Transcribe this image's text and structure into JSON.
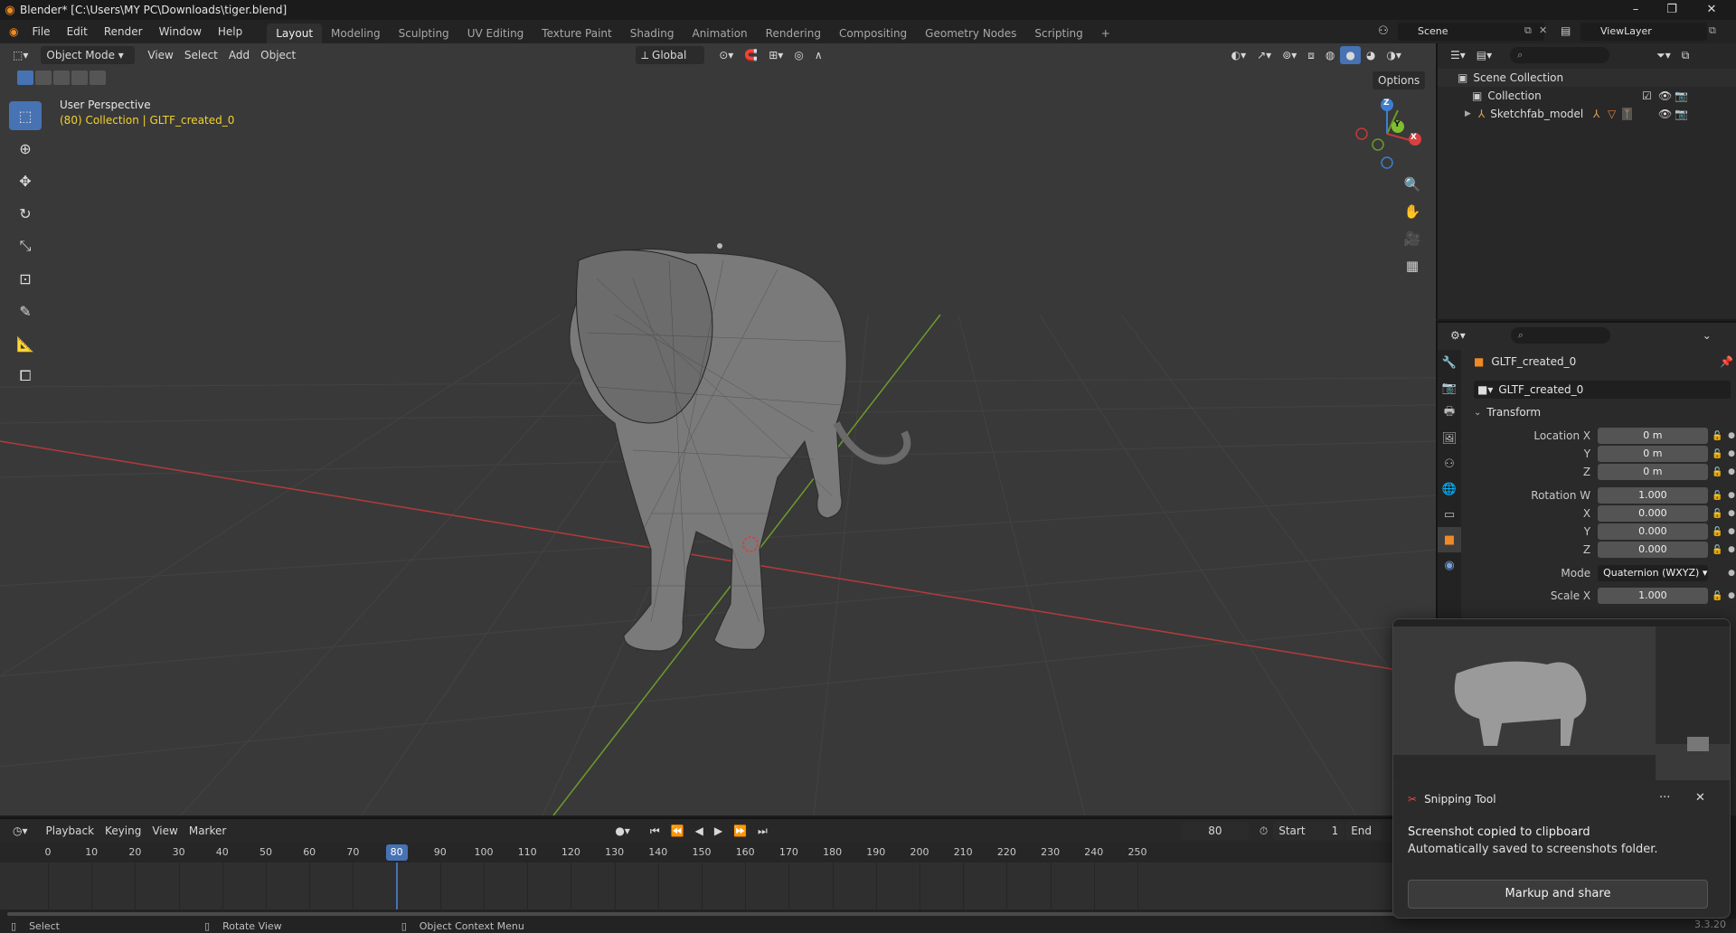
{
  "window": {
    "title": "Blender* [C:\\Users\\MY PC\\Downloads\\tiger.blend]",
    "controls": [
      "–",
      "❐",
      "✕"
    ]
  },
  "menu": {
    "items": [
      "File",
      "Edit",
      "Render",
      "Window",
      "Help"
    ],
    "workspaces": [
      "Layout",
      "Modeling",
      "Sculpting",
      "UV Editing",
      "Texture Paint",
      "Shading",
      "Animation",
      "Rendering",
      "Compositing",
      "Geometry Nodes",
      "Scripting"
    ],
    "active_workspace": "Layout",
    "add_tab": "+",
    "scene": "Scene",
    "view_layer": "ViewLayer"
  },
  "viewport": {
    "mode": "Object Mode",
    "menus": [
      "View",
      "Select",
      "Add",
      "Object"
    ],
    "orientation": "Global",
    "options_label": "Options",
    "perspective": "User Perspective",
    "context": "(80) Collection | GLTF_created_0",
    "axes": {
      "x": "X",
      "y": "Y",
      "z": "Z"
    }
  },
  "outliner": {
    "scene_collection": "Scene Collection",
    "collection": "Collection",
    "object": "Sketchfab_model"
  },
  "properties": {
    "object_name": "GLTF_created_0",
    "datablock": "GLTF_created_0",
    "panel": "Transform",
    "location": {
      "label_x": "Location X",
      "label_y": "Y",
      "label_z": "Z",
      "x": "0 m",
      "y": "0 m",
      "z": "0 m"
    },
    "rotation": {
      "label_w": "Rotation W",
      "label_x": "X",
      "label_y": "Y",
      "label_z": "Z",
      "w": "1.000",
      "x": "0.000",
      "y": "0.000",
      "z": "0.000"
    },
    "mode_label": "Mode",
    "mode_value": "Quaternion (WXYZ)",
    "scale": {
      "label_x": "Scale X",
      "x": "1.000"
    }
  },
  "timeline": {
    "menus": [
      "Playback",
      "Keying",
      "View",
      "Marker"
    ],
    "current_frame": "80",
    "start_label": "Start",
    "start_value": "1",
    "end_label": "End",
    "ticks": [
      "0",
      "10",
      "20",
      "30",
      "40",
      "50",
      "60",
      "70",
      "80",
      "90",
      "100",
      "110",
      "120",
      "130",
      "140",
      "150",
      "160",
      "170",
      "180",
      "190",
      "200",
      "210",
      "220",
      "230",
      "240",
      "250"
    ]
  },
  "statusbar": {
    "select": "Select",
    "rotate": "Rotate View",
    "context_menu": "Object Context Menu",
    "version": "3.3.20"
  },
  "toast": {
    "app": "Snipping Tool",
    "line1": "Screenshot copied to clipboard",
    "line2": "Automatically saved to screenshots folder.",
    "button": "Markup and share",
    "more": "···",
    "close": "✕"
  },
  "colors": {
    "accent": "#4772b3",
    "x_axis": "#c23a3a",
    "y_axis": "#6a9a2a",
    "context_text": "#f2d22b",
    "blender_orange": "#f08a24"
  }
}
